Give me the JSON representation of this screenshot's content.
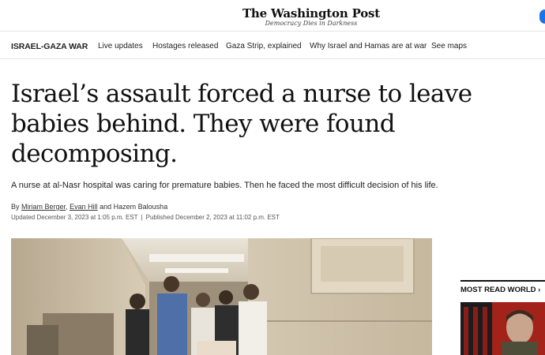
{
  "masthead": {
    "logo": "The Washington Post",
    "tagline": "Democracy Dies in Darkness"
  },
  "nav": {
    "items": [
      {
        "label": "ISRAEL-GAZA WAR"
      },
      {
        "label": "Live updates"
      },
      {
        "label": "Hostages released"
      },
      {
        "label": "Gaza Strip, explained"
      },
      {
        "label": "Why Israel and Hamas are at war"
      },
      {
        "label": "See maps"
      }
    ]
  },
  "article": {
    "headline": "Israel’s assault forced a nurse to leave babies behind. They were found decomposing.",
    "dek": "A nurse at al-Nasr hospital was caring for premature babies. Then he faced the most difficult decision of his life.",
    "byline": {
      "prefix": "By",
      "authors": [
        "Miriam Berger",
        "Evan Hill"
      ],
      "and": "and",
      "last_author": "Hazem Balousha"
    },
    "updated": "Updated December 3, 2023 at 1:05 p.m. EST",
    "separator": "|",
    "published": "Published December 2, 2023 at 11:02 p.m. EST"
  },
  "sidebar": {
    "title": "MOST READ WORLD",
    "chevron": "›"
  },
  "colors": {
    "accent": "#1a73e8",
    "sidebar_thumb": "#b3261e"
  }
}
